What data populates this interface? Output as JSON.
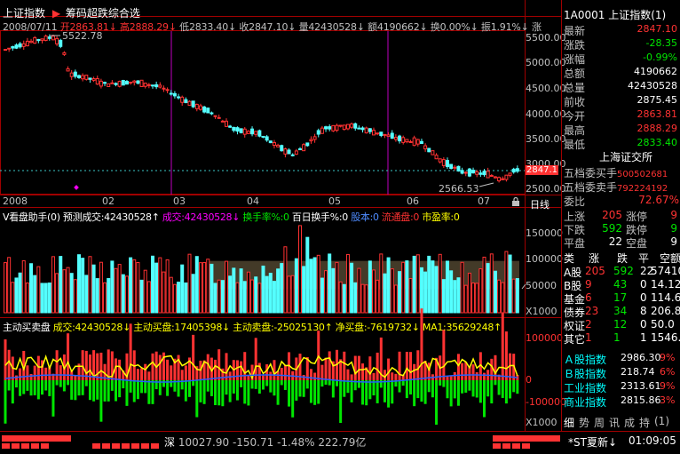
{
  "index_name": "上证指数",
  "formula_name": "筹码超跌综合选",
  "ohlc_bar": {
    "date": "2008/07/11",
    "open": "开2863.81",
    "high": "高2888.29",
    "low": "低2833.40",
    "close": "收2847.10",
    "volume": "量42430528",
    "amount": "额4190662",
    "turnover": "换0.00%",
    "amplitude": "振1.91%",
    "tail": "涨"
  },
  "price_axis": [
    "5500.00",
    "5000.00",
    "4500.00",
    "4000.00",
    "3500.00",
    "3000.00",
    "2500.00"
  ],
  "current_price_tag": "2847.1",
  "peak_label": "5522.78",
  "low_label": "2566.53",
  "month_labels": [
    "2008",
    "02",
    "03",
    "04",
    "05",
    "06",
    "07"
  ],
  "tab_daily": "日线",
  "vol_header": {
    "name": "V看盘助手(0)",
    "forecast": "预测成交:42430528↑",
    "trade": "成交:42430528↓",
    "turnover": "换手率%:0",
    "hundred_day": "百日换手%:0",
    "capital": "股本:0",
    "float": "流通盘:0",
    "pe": "市盈率:0"
  },
  "vol_axis": [
    "150000",
    "100000",
    "50000",
    "X1000"
  ],
  "flow_header": {
    "name": "主动买卖盘",
    "trade": "成交:42430528↓",
    "buy": "主动买盘:17405398↓",
    "sell": "主动卖盘:-25025130↑",
    "net": "净买盘:-7619732↓",
    "ma": "MA1:35629248↑"
  },
  "flow_axis": [
    "100000",
    "0",
    "-100000",
    "X1000"
  ],
  "panel": {
    "code": "1A0001",
    "name": "上证指数",
    "suffix": "(1)",
    "rows": [
      {
        "label": "最新",
        "value": "2847.10",
        "color": "#ff3232"
      },
      {
        "label": "涨跌",
        "value": "-28.35",
        "color": "#00e600"
      },
      {
        "label": "涨幅",
        "value": "-0.99%",
        "color": "#00e600"
      },
      {
        "label": "总额",
        "value": "4190662",
        "color": "#ffffff"
      },
      {
        "label": "总量",
        "value": "42430528",
        "color": "#ffffff"
      },
      {
        "label": "前收",
        "value": "2875.45",
        "color": "#ffffff"
      },
      {
        "label": "今开",
        "value": "2863.81",
        "color": "#ff3232"
      },
      {
        "label": "最高",
        "value": "2888.29",
        "color": "#ff3232"
      },
      {
        "label": "最低",
        "value": "2833.40",
        "color": "#00e600"
      }
    ],
    "exchange": "上海证交所",
    "five_buy_label": "五档委买手",
    "five_buy_value": "500502681",
    "five_sell_label": "五档委卖手",
    "five_sell_value": "792224192",
    "ratio_label": "委比",
    "ratio_value": "72.67%",
    "up_label": "上涨",
    "up_value": "205",
    "up_stop_label": "涨停",
    "up_stop_value": "9",
    "down_label": "下跌",
    "down_value": "592",
    "down_stop_label": "跌停",
    "down_stop_value": "9",
    "flat_label": "平盘",
    "flat_value": "22",
    "empty_label": "空盘",
    "empty_value": "9",
    "grid_headers": [
      "类",
      "涨",
      "跌",
      "平",
      "空额"
    ],
    "grid_rows": [
      {
        "type": "A股",
        "up": "205",
        "down": "592",
        "flat": "22",
        "amt": "57410"
      },
      {
        "type": "B股",
        "up": "9",
        "down": "43",
        "flat": "0",
        "amt": "14.12"
      },
      {
        "type": "基金",
        "up": "6",
        "down": "17",
        "flat": "0",
        "amt": "114.64"
      },
      {
        "type": "债券",
        "up": "23",
        "down": "34",
        "flat": "8",
        "amt": "206.85"
      },
      {
        "type": "权证",
        "up": "2",
        "down": "12",
        "flat": "0",
        "amt": "50.0"
      },
      {
        "type": "其它",
        "up": "1",
        "down": "1",
        "flat": "1",
        "amt": "1546.8"
      }
    ],
    "sub_indices": [
      {
        "name": "Ａ股指数",
        "value": "2986.30",
        "pct": "9%"
      },
      {
        "name": "Ｂ股指数",
        "value": "218.74",
        "pct": "6%"
      },
      {
        "name": "工业指数",
        "value": "2313.61",
        "pct": "9%"
      },
      {
        "name": "商业指数",
        "value": "2815.86",
        "pct": "3%"
      }
    ],
    "tabs": [
      "细",
      "势",
      "周",
      "讯",
      "成",
      "持",
      "(1)"
    ]
  },
  "status": {
    "market": "深",
    "index": "10027.90",
    "change": "-150.71",
    "pct": "-1.48%",
    "amount": "222.79亿",
    "news": "*ST夏新↓",
    "time": "01:09:05"
  },
  "colors": {
    "red": "#ff3232",
    "green": "#00e600",
    "cyan": "#54ffff",
    "yellow": "#ffff00",
    "magenta": "#ff00ff",
    "blue": "#2060ff",
    "frame": "#a00000"
  }
}
